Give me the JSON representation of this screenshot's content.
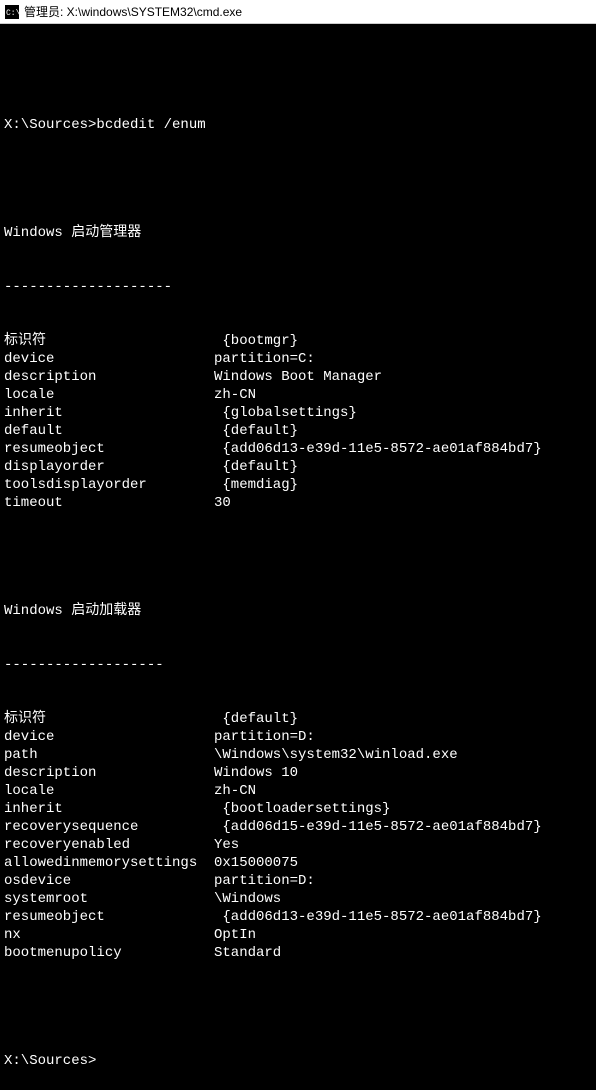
{
  "titlebar": {
    "text": "管理员: X:\\windows\\SYSTEM32\\cmd.exe"
  },
  "prompt1": {
    "path": "X:\\Sources>",
    "command": "bcdedit /enum"
  },
  "section1": {
    "title": "Windows 启动管理器",
    "divider": "--------------------",
    "entries": [
      {
        "key": "标识符",
        "val": " {bootmgr}"
      },
      {
        "key": "device",
        "val": "partition=C:"
      },
      {
        "key": "description",
        "val": "Windows Boot Manager"
      },
      {
        "key": "locale",
        "val": "zh-CN"
      },
      {
        "key": "inherit",
        "val": " {globalsettings}"
      },
      {
        "key": "default",
        "val": " {default}"
      },
      {
        "key": "resumeobject",
        "val": " {add06d13-e39d-11e5-8572-ae01af884bd7}"
      },
      {
        "key": "displayorder",
        "val": " {default}"
      },
      {
        "key": "toolsdisplayorder",
        "val": " {memdiag}"
      },
      {
        "key": "timeout",
        "val": "30"
      }
    ]
  },
  "section2": {
    "title": "Windows 启动加载器",
    "divider": "-------------------",
    "entries": [
      {
        "key": "标识符",
        "val": " {default}"
      },
      {
        "key": "device",
        "val": "partition=D:"
      },
      {
        "key": "path",
        "val": "\\Windows\\system32\\winload.exe"
      },
      {
        "key": "description",
        "val": "Windows 10"
      },
      {
        "key": "locale",
        "val": "zh-CN"
      },
      {
        "key": "inherit",
        "val": " {bootloadersettings}"
      },
      {
        "key": "recoverysequence",
        "val": " {add06d15-e39d-11e5-8572-ae01af884bd7}"
      },
      {
        "key": "recoveryenabled",
        "val": "Yes"
      },
      {
        "key": "allowedinmemorysettings",
        "val": "0x15000075"
      },
      {
        "key": "osdevice",
        "val": "partition=D:"
      },
      {
        "key": "systemroot",
        "val": "\\Windows"
      },
      {
        "key": "resumeobject",
        "val": " {add06d13-e39d-11e5-8572-ae01af884bd7}"
      },
      {
        "key": "nx",
        "val": "OptIn"
      },
      {
        "key": "bootmenupolicy",
        "val": "Standard"
      }
    ]
  },
  "prompt2": {
    "path": "X:\\Sources>"
  }
}
